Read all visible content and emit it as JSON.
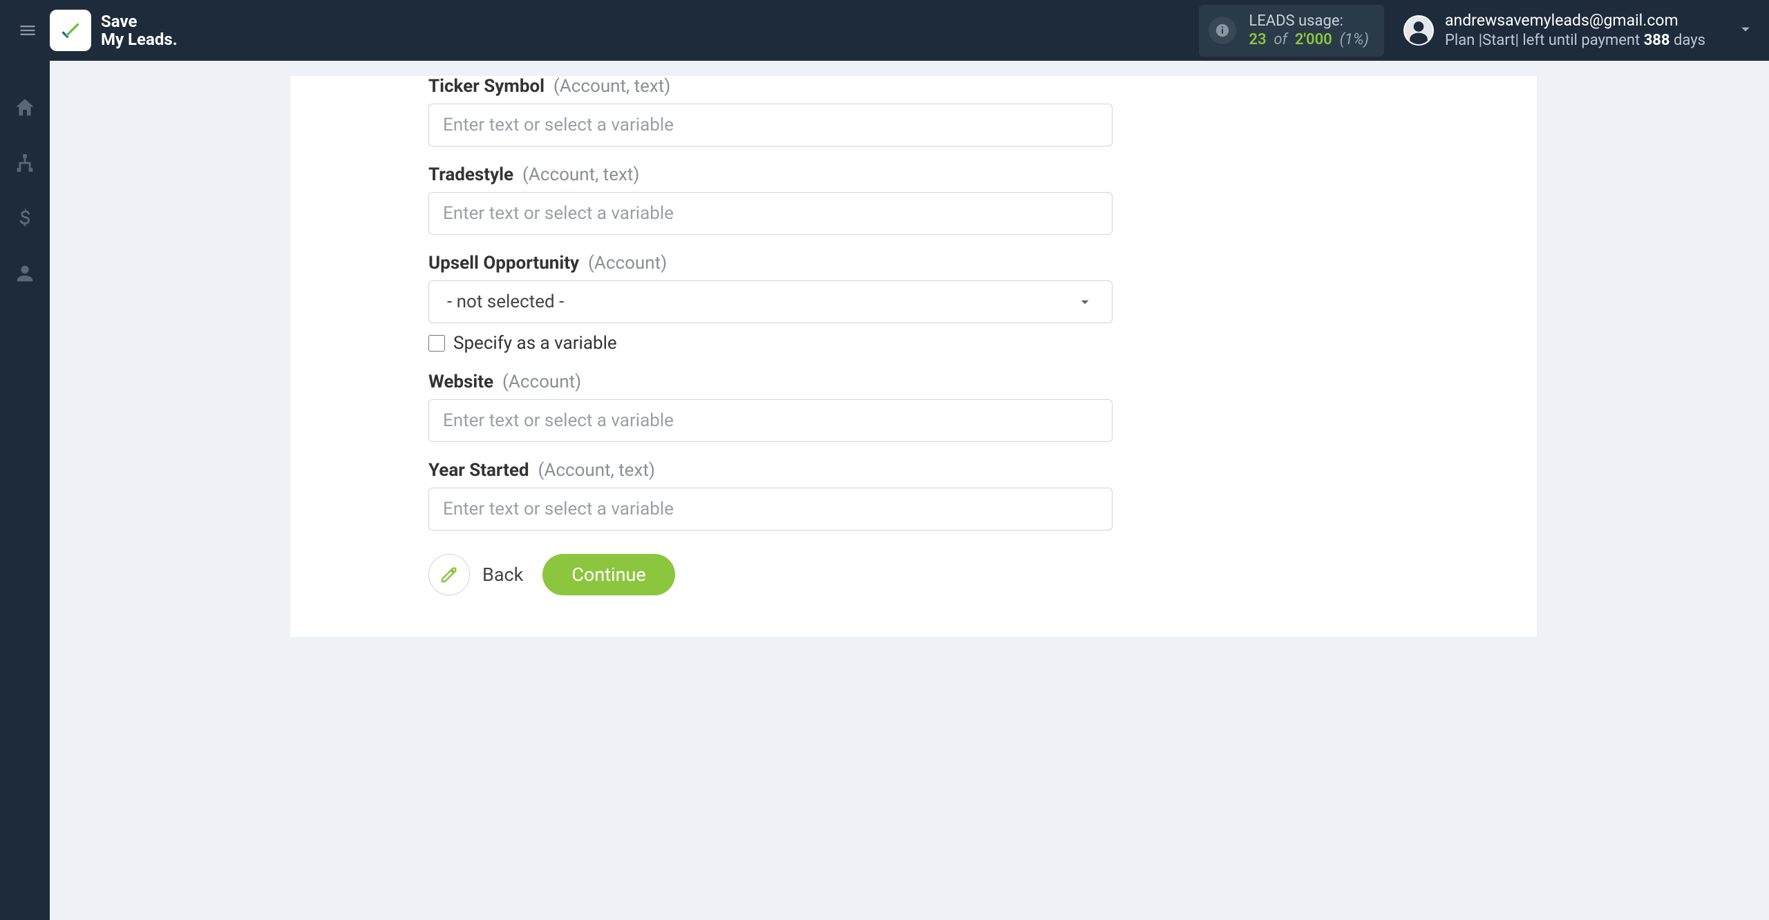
{
  "app": {
    "name_line1": "Save",
    "name_line2": "My Leads."
  },
  "usage": {
    "title": "LEADS usage:",
    "used": "23",
    "of": "of",
    "total": "2'000",
    "pct": "(1%)"
  },
  "account": {
    "email": "andrewsavemyleads@gmail.com",
    "plan_prefix": "Plan |Start| left until payment ",
    "days_num": "388",
    "days_suffix": " days"
  },
  "fields": {
    "ticker": {
      "label": "Ticker Symbol",
      "hint": "(Account, text)",
      "placeholder": "Enter text or select a variable"
    },
    "tradestyle": {
      "label": "Tradestyle",
      "hint": "(Account, text)",
      "placeholder": "Enter text or select a variable"
    },
    "upsell": {
      "label": "Upsell Opportunity",
      "hint": "(Account)",
      "selected": "- not selected -",
      "specify": "Specify as a variable"
    },
    "website": {
      "label": "Website",
      "hint": "(Account)",
      "placeholder": "Enter text or select a variable"
    },
    "year": {
      "label": "Year Started",
      "hint": "(Account, text)",
      "placeholder": "Enter text or select a variable"
    }
  },
  "buttons": {
    "back": "Back",
    "continue": "Continue"
  }
}
